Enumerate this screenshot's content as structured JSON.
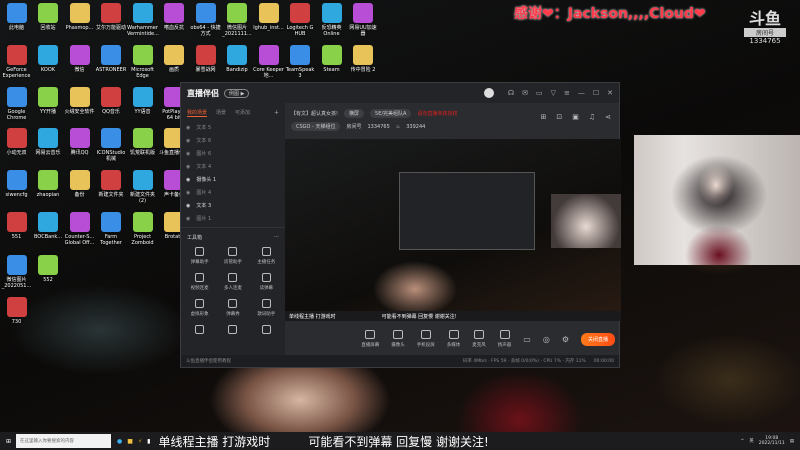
{
  "desktop_icons": [
    [
      "此电脑",
      "回收站",
      "Phasmop...",
      "艾尔万能驱动",
      "Warhammer Vermintide...",
      "嗜血反抗",
      "obs64 - 快捷方式",
      "微信图片_2021111...",
      "lghub_inst...",
      "Logitech G HUB",
      "反恐精英Online",
      "网易UU加速器"
    ],
    [
      "GeForce Experience",
      "KOOK",
      "微信",
      "ASTRONEER",
      "Microsoft Edge",
      "画质",
      "暴雪战网",
      "Bandizip",
      "Core Keeper 地...",
      "TeamSpeak 3",
      "Steam",
      "传中冒险 2"
    ],
    [
      "Google Chrome",
      "YY开播",
      "火绒安全软件",
      "QQ音乐",
      "YY语音",
      "PotPlayer 64 bit"
    ],
    [
      "小动无双",
      "网易云音乐",
      "腾讯QQ",
      "ICONStudio 机械",
      "饥荒联机版",
      "斗鱼直播伴侣"
    ],
    [
      "siwencfg",
      "zhaopian",
      "备份",
      "新建文件夹",
      "新建文件夹 (2)",
      "声卡备份"
    ],
    [
      "551",
      "BOCBank...",
      "Counter-S... Global Off...",
      "Farm Together",
      "Project Zomboid",
      "Brotato"
    ],
    [
      "微信图片_2022051...",
      "552"
    ],
    [
      "730"
    ]
  ],
  "icon_colors": [
    "#3a8ee6",
    "#8ad14a",
    "#e8c35a",
    "#d04040",
    "#2fa8e0",
    "#b84dd6"
  ],
  "overlay": {
    "thanks": "感谢❤：Jackson,,,,Cloud❤",
    "douyu_logo": "斗鱼",
    "room_label": "房间号",
    "room_number": "1334765"
  },
  "app": {
    "title": "直播伴侣",
    "pill": "例图 ▶",
    "tabs": [
      "我的场景",
      "场景",
      "可添加"
    ],
    "layers": [
      {
        "name": "文本 5",
        "on": false
      },
      {
        "name": "文本 6",
        "on": false
      },
      {
        "name": "图片 6",
        "on": false
      },
      {
        "name": "文本 4",
        "on": false
      },
      {
        "name": "摄像头 1",
        "on": true
      },
      {
        "name": "图片 4",
        "on": false
      },
      {
        "name": "文本 3",
        "on": true
      },
      {
        "name": "图片 1",
        "on": false
      }
    ],
    "toolbox_title": "工具箱",
    "tools": [
      "弹幕助手",
      "房管助手",
      "主播任务",
      "视频连麦",
      "多人连麦",
      "读弹幕",
      "虚拟形象",
      "弹幕秀",
      "歌词助手",
      "",
      "",
      ""
    ],
    "stream_title": "【有文】超认真女孩!",
    "orientation": "横屏",
    "tag": "5E/完美组队A",
    "warning": "请勿直播未获授权",
    "category": "CSGO - 天梯组位",
    "room_label": "房间号",
    "room_number": "1334765",
    "heat": "339244",
    "preview_taskbar_text": "单线程主播 打游戏时",
    "preview_taskbar_text2": "可能看不到弹幕 回复慢 谢谢关注!",
    "controls": [
      "直播屏幕",
      "摄像头",
      "手机投屏",
      "多媒体",
      "麦克风",
      "扬声器"
    ],
    "live_button": "关闭直播",
    "tutorial": "斗鱼直播伴侣使用教程",
    "stats": "码率 4Mb/s · FPS 59 · 丢帧 0/0(0%) · CPU 7% · 内存 11%",
    "timer": "00:00:00"
  },
  "taskbar": {
    "search_placeholder": "在这里输入你要搜索的内容",
    "marquee1": "单线程主播 打游戏时",
    "marquee2": "可能看不到弹幕 回复慢 谢谢关注!",
    "ime": "英",
    "time": "19:08",
    "date": "2022/11/11"
  }
}
